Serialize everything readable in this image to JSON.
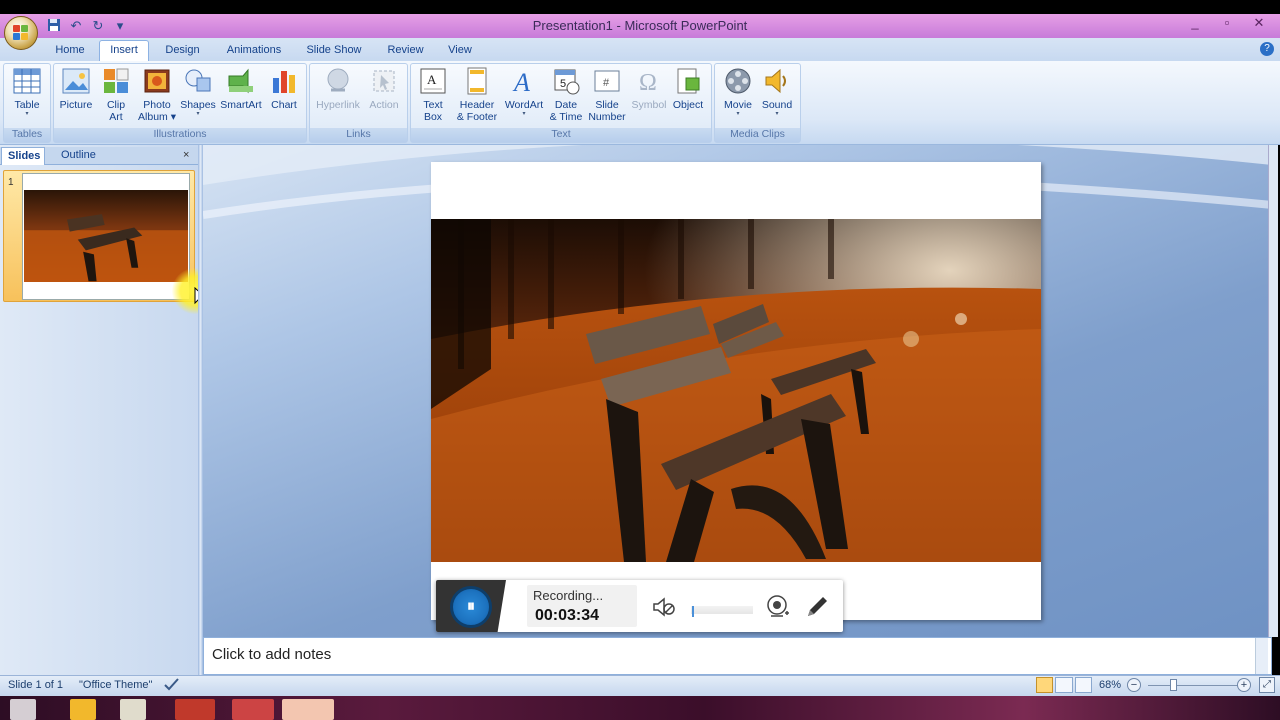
{
  "window": {
    "title": "Presentation1 - Microsoft PowerPoint",
    "minimize": "_",
    "restore": "▫",
    "close": "✕"
  },
  "quick_access": {
    "save_icon": "💾",
    "undo_icon": "↶",
    "redo_icon": "↻",
    "customize_icon": "▾"
  },
  "tabs": [
    {
      "label": "Home"
    },
    {
      "label": "Insert",
      "active": true
    },
    {
      "label": "Design"
    },
    {
      "label": "Animations"
    },
    {
      "label": "Slide Show"
    },
    {
      "label": "Review"
    },
    {
      "label": "View"
    }
  ],
  "ribbon": {
    "groups": [
      {
        "caption": "Tables"
      },
      {
        "caption": "Illustrations"
      },
      {
        "caption": "Links"
      },
      {
        "caption": "Text"
      },
      {
        "caption": "Media Clips"
      }
    ],
    "buttons": {
      "table": {
        "line1": "Table",
        "line2": "▾"
      },
      "picture": {
        "line1": "Picture",
        "line2": ""
      },
      "clipart": {
        "line1": "Clip",
        "line2": "Art"
      },
      "photoalbum": {
        "line1": "Photo",
        "line2": "Album ▾"
      },
      "shapes": {
        "line1": "Shapes",
        "line2": "▾"
      },
      "smartart": {
        "line1": "SmartArt",
        "line2": ""
      },
      "chart": {
        "line1": "Chart",
        "line2": ""
      },
      "hyperlink": {
        "line1": "Hyperlink",
        "line2": ""
      },
      "action": {
        "line1": "Action",
        "line2": ""
      },
      "textbox": {
        "line1": "Text",
        "line2": "Box"
      },
      "headerfooter": {
        "line1": "Header",
        "line2": "& Footer"
      },
      "wordart": {
        "line1": "WordArt",
        "line2": "▾"
      },
      "datetime": {
        "line1": "Date",
        "line2": "& Time"
      },
      "slidenumber": {
        "line1": "Slide",
        "line2": "Number"
      },
      "symbol": {
        "line1": "Symbol",
        "line2": ""
      },
      "object": {
        "line1": "Object",
        "line2": ""
      },
      "movie": {
        "line1": "Movie",
        "line2": "▾"
      },
      "sound": {
        "line1": "Sound",
        "line2": "▾"
      }
    }
  },
  "panel": {
    "tab_slides": "Slides",
    "tab_outline": "Outline",
    "close": "×",
    "slide_number": "1"
  },
  "notes": {
    "placeholder": "Click to add notes"
  },
  "status": {
    "slide": "Slide 1 of 1",
    "theme": "\"Office Theme\"",
    "zoom": "68%",
    "zoom_out": "−",
    "zoom_in": "+"
  },
  "recorder": {
    "pause_icon": "⏸",
    "label": "Recording...",
    "time": "00:03:34"
  },
  "colors": {
    "title_bar": "#c77bd9",
    "ribbon": "#dce8f7",
    "stage": "#8aa9d4",
    "selected_thumb": "#f7c15b",
    "record_button": "#1d73c0"
  }
}
